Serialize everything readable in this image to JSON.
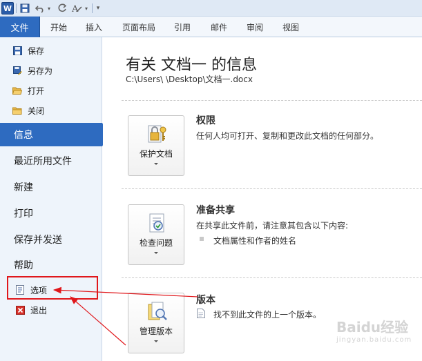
{
  "ribbon": {
    "file_tab": "文件",
    "tabs": [
      "开始",
      "插入",
      "页面布局",
      "引用",
      "邮件",
      "审阅",
      "视图"
    ]
  },
  "nav": {
    "small_top": [
      {
        "label": "保存",
        "icon": "save-icon"
      },
      {
        "label": "另存为",
        "icon": "save-as-icon"
      },
      {
        "label": "打开",
        "icon": "open-folder-icon"
      },
      {
        "label": "关闭",
        "icon": "close-folder-icon"
      }
    ],
    "big": [
      {
        "label": "信息",
        "active": true
      },
      {
        "label": "最近所用文件"
      },
      {
        "label": "新建"
      },
      {
        "label": "打印"
      },
      {
        "label": "保存并发送"
      },
      {
        "label": "帮助"
      }
    ],
    "small_bottom": [
      {
        "label": "选项",
        "icon": "options-icon"
      },
      {
        "label": "退出",
        "icon": "exit-icon"
      }
    ]
  },
  "main": {
    "title": "有关 文档一 的信息",
    "path": "C:\\Users\\            \\Desktop\\文档一.docx",
    "sections": [
      {
        "button": "保护文档",
        "button_icon": "lock-key-icon",
        "title": "权限",
        "desc": "任何人均可打开、复制和更改此文档的任何部分。"
      },
      {
        "button": "检查问题",
        "button_icon": "inspect-document-icon",
        "title": "准备共享",
        "desc": "在共享此文件前，请注意其包含以下内容:",
        "items": [
          "文档属性和作者的姓名"
        ]
      },
      {
        "button": "管理版本",
        "button_icon": "manage-versions-icon",
        "title": "版本",
        "items": [
          "找不到此文件的上一个版本。"
        ]
      }
    ]
  },
  "colors": {
    "accent": "#2e6bc0",
    "annotation": "#e0171b"
  },
  "watermark": {
    "main": "Baidu经验",
    "sub": "jingyan.baidu.com"
  }
}
